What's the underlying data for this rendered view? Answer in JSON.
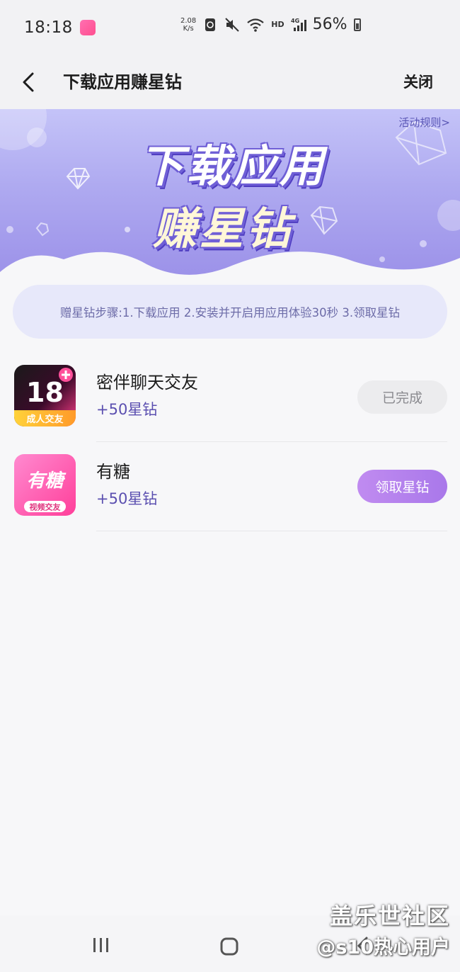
{
  "status_bar": {
    "time": "18:18",
    "net_speed_value": "2.08",
    "net_speed_unit": "K/s",
    "network_label": "HD",
    "network_type": "4G",
    "battery": "56%"
  },
  "nav": {
    "title": "下载应用赚星钻",
    "close_label": "关闭"
  },
  "banner": {
    "rules_link": "活动规则>",
    "title_line1": "下载应用",
    "title_line2": "赚星钻"
  },
  "steps": {
    "text": "赠星钻步骤:1.下载应用 2.安装并开启用应用体验30秒 3.领取星钻"
  },
  "apps": [
    {
      "name": "密伴聊天交友",
      "reward": "+50星钻",
      "button": "已完成",
      "icon_text": "18",
      "icon_sub": "成人交友"
    },
    {
      "name": "有糖",
      "reward": "+50星钻",
      "button": "领取星钻",
      "icon_text": "有糖",
      "icon_sub": "视频交友"
    }
  ],
  "watermark": {
    "line1": "盖乐世社区",
    "line2": "@s10热心用户"
  },
  "colors": {
    "accent": "#a978ea",
    "banner": "#aea9f0",
    "reward": "#5b4fb0"
  }
}
